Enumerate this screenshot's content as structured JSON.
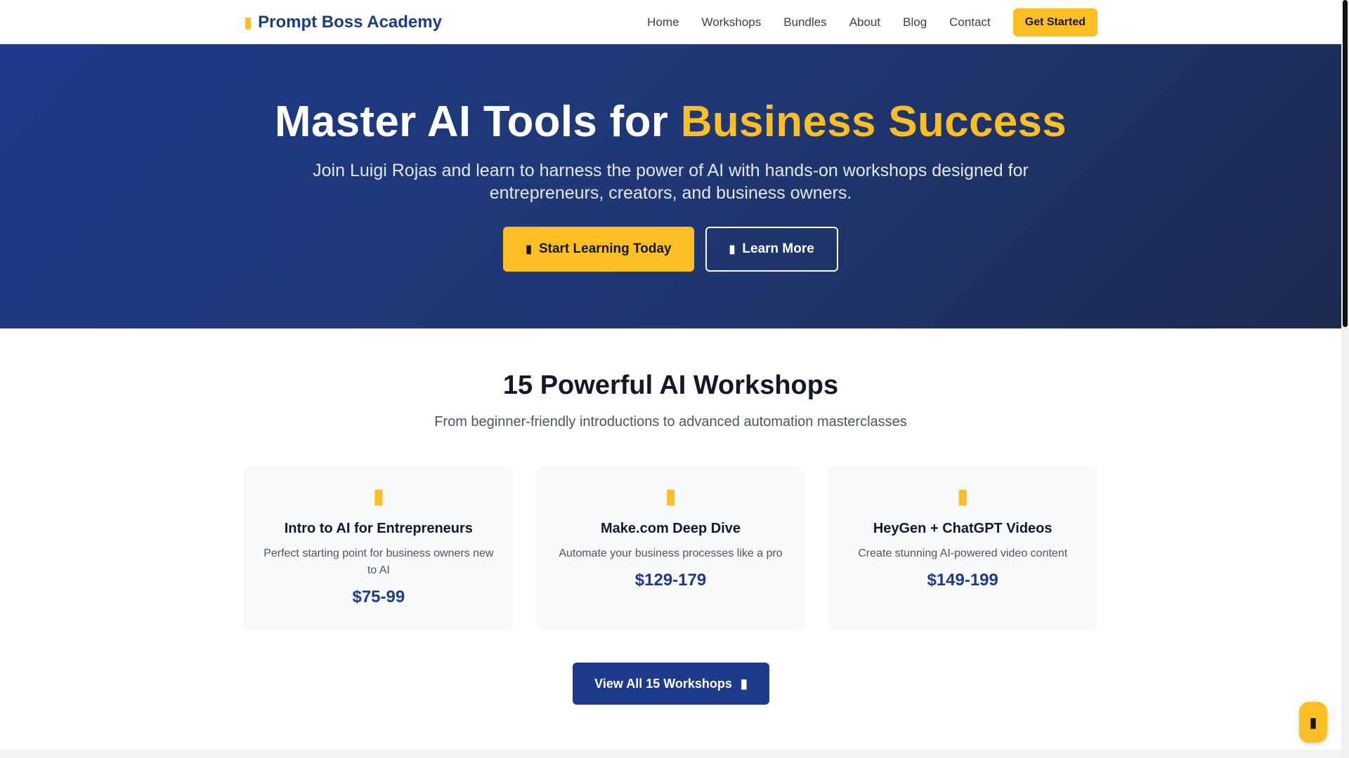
{
  "nav": {
    "brand": "Prompt Boss Academy",
    "brand_icon": "robot-icon",
    "links": [
      "Home",
      "Workshops",
      "Bundles",
      "About",
      "Blog",
      "Contact"
    ],
    "cta": "Get Started"
  },
  "hero": {
    "title_main": "Master AI Tools for ",
    "title_accent": "Business Success",
    "subtitle": "Join Luigi Rojas and learn to harness the power of AI with hands-on workshops designed for entrepreneurs, creators, and business owners.",
    "primary_button": "Start Learning Today",
    "primary_icon": "rocket-icon",
    "secondary_button": "Learn More",
    "secondary_icon": "play-icon"
  },
  "workshops": {
    "title": "15 Powerful AI Workshops",
    "subtitle": "From beginner-friendly introductions to advanced automation masterclasses",
    "cards": [
      {
        "icon": "lightbulb-icon",
        "title": "Intro to AI for Entrepreneurs",
        "description": "Perfect starting point for business owners new to AI",
        "price": "$75-99"
      },
      {
        "icon": "cogs-icon",
        "title": "Make.com Deep Dive",
        "description": "Automate your business processes like a pro",
        "price": "$129-179"
      },
      {
        "icon": "video-icon",
        "title": "HeyGen + ChatGPT Videos",
        "description": "Create stunning AI-powered video content",
        "price": "$149-199"
      }
    ],
    "view_all": "View All 15 Workshops",
    "view_all_icon": "arrow-right-icon"
  },
  "floating_button_icon": "chat-icon",
  "colors": {
    "brand_navy": "#1e3a8a",
    "accent_yellow": "#fbbf24",
    "hero_gradient_end": "#1c2a4f"
  }
}
